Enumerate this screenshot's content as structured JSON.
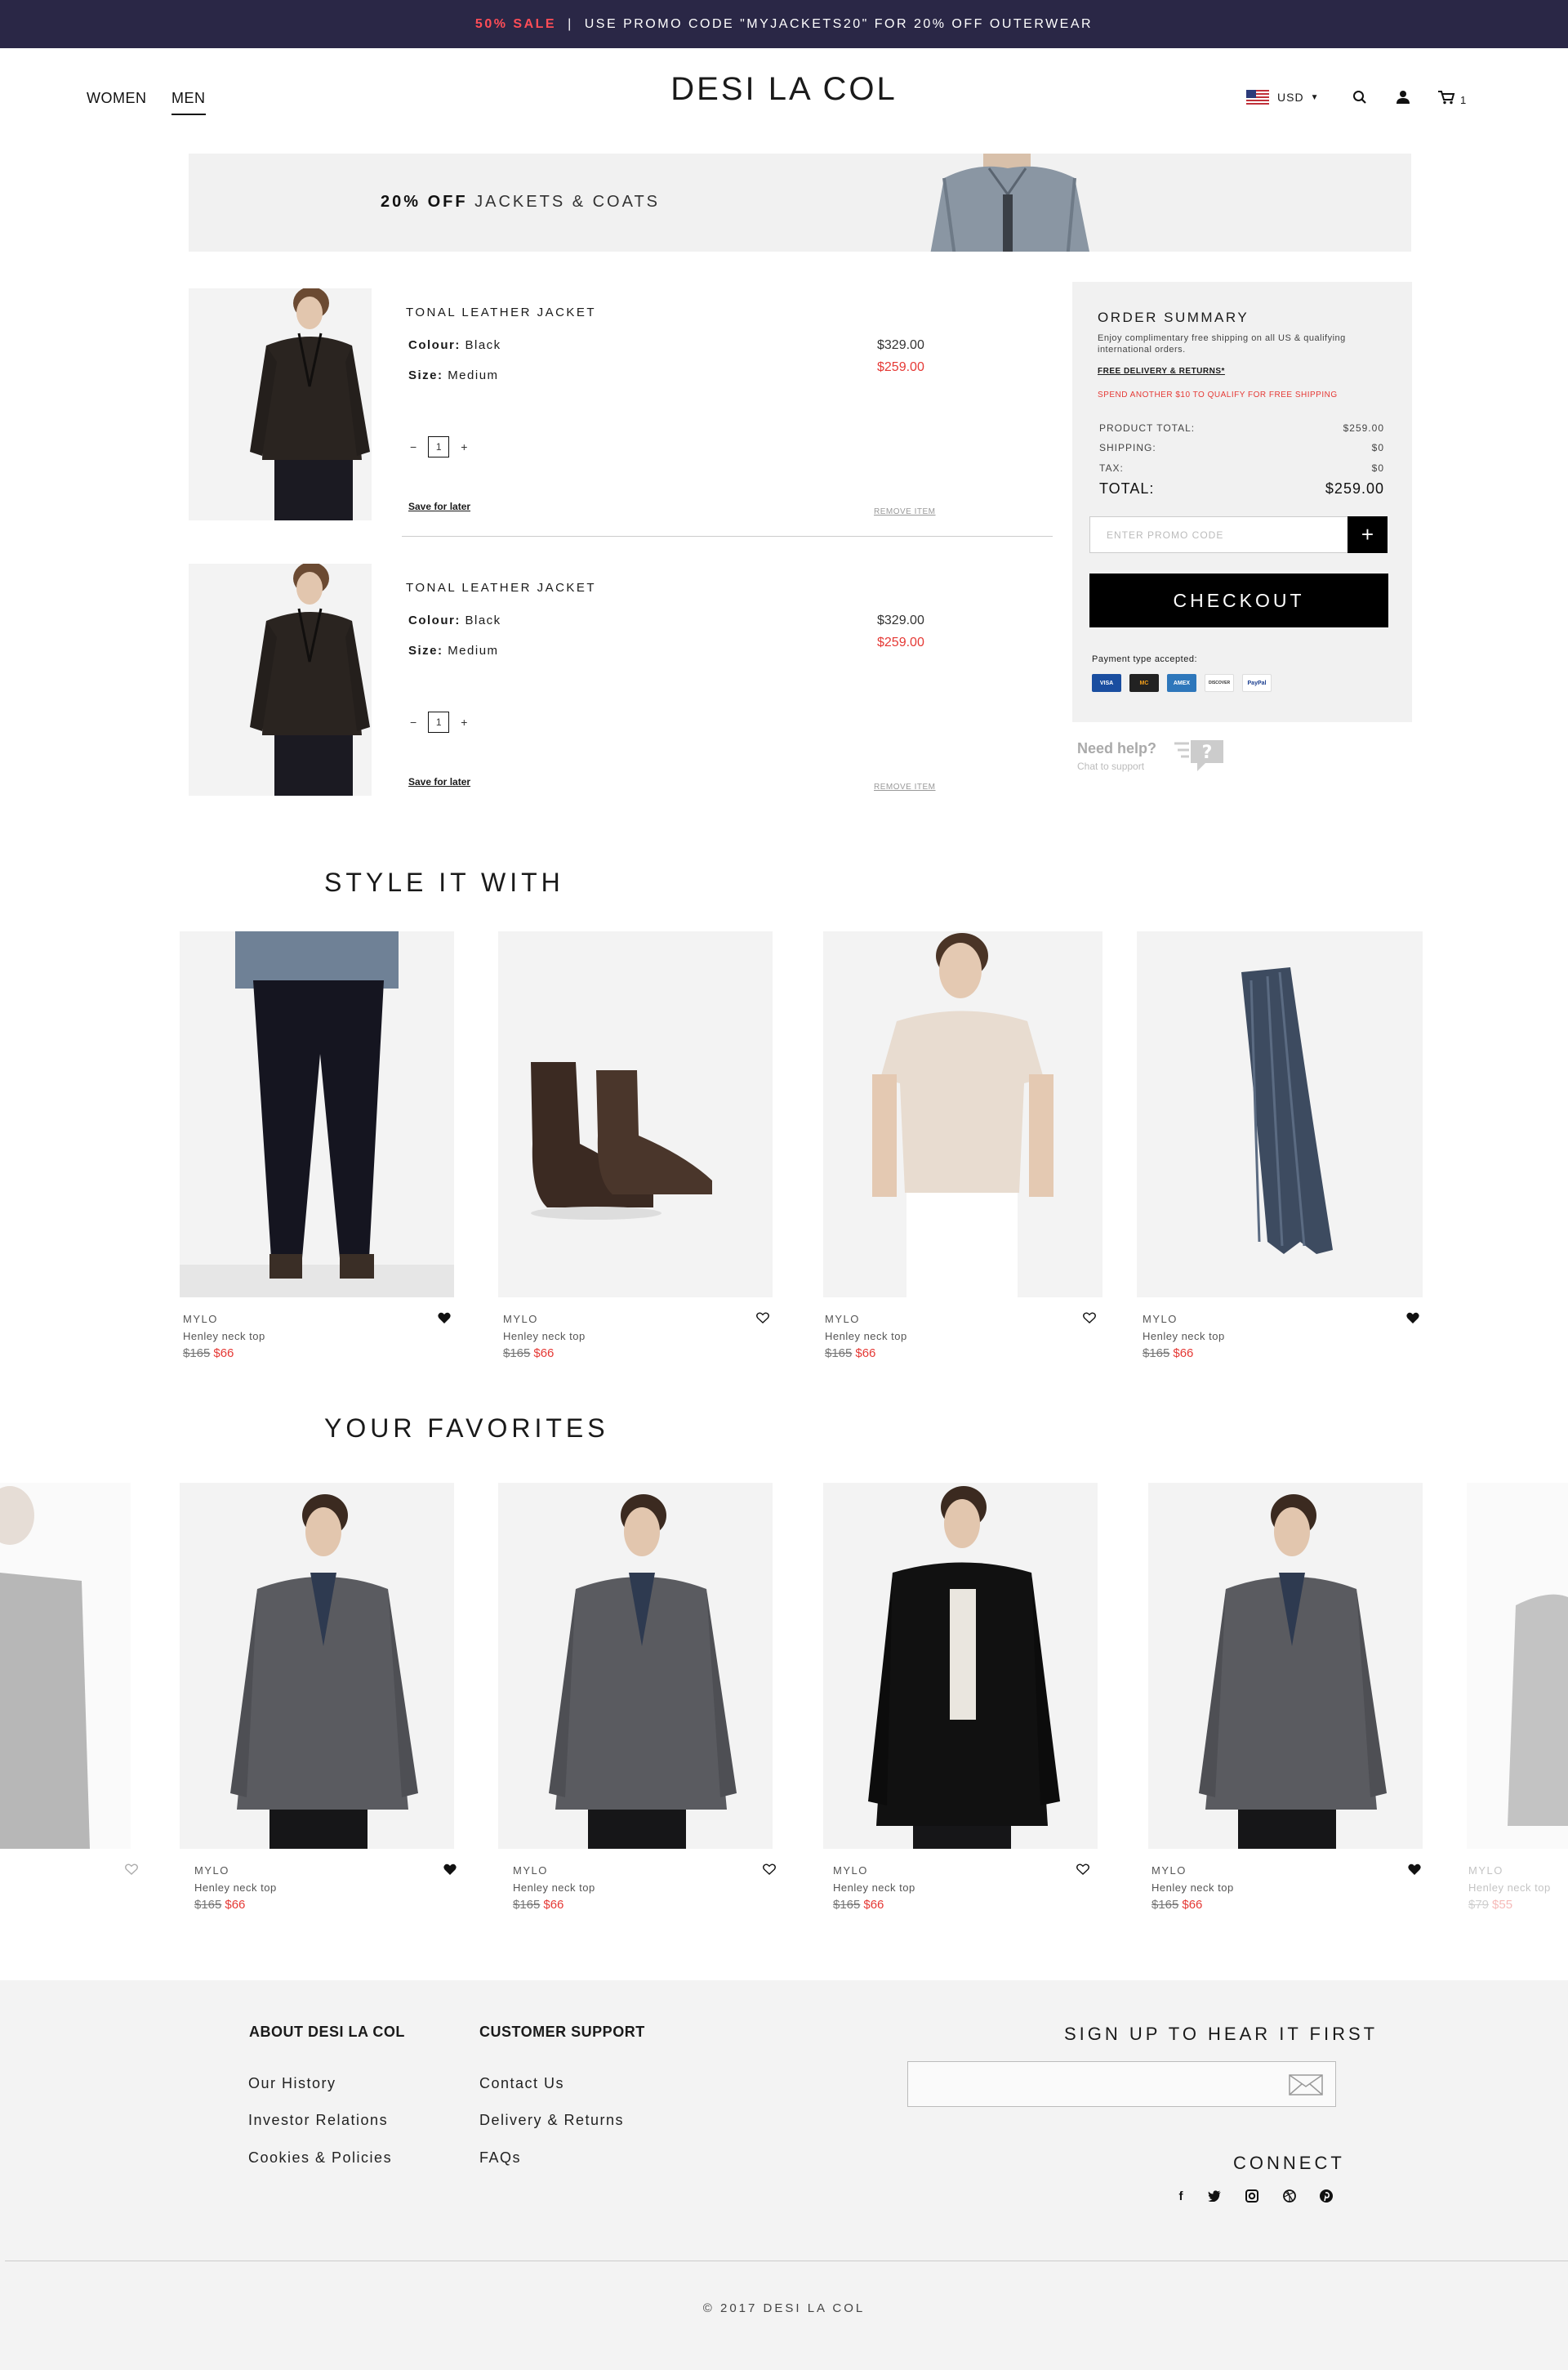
{
  "promo": {
    "sale": "50% SALE",
    "separator": "|",
    "message": "USE PROMO CODE \"MYJACKETS20\" FOR 20% OFF OUTERWEAR"
  },
  "header": {
    "nav_women": "WOMEN",
    "nav_men": "MEN",
    "logo": "DESI LA COL",
    "currency": "USD",
    "cart_count": "1"
  },
  "banner": {
    "highlight": "20% OFF",
    "text": "JACKETS & COATS"
  },
  "cart": {
    "items": [
      {
        "name": "TONAL LEATHER JACKET",
        "colour_label": "Colour:",
        "colour": "Black",
        "size_label": "Size:",
        "size": "Medium",
        "price_old": "$329.00",
        "price_new": "$259.00",
        "minus": "−",
        "qty": "1",
        "plus": "+",
        "save_later": "Save for later",
        "remove": "REMOVE ITEM"
      },
      {
        "name": "TONAL LEATHER JACKET",
        "colour_label": "Colour:",
        "colour": "Black",
        "size_label": "Size:",
        "size": "Medium",
        "price_old": "$329.00",
        "price_new": "$259.00",
        "minus": "−",
        "qty": "1",
        "plus": "+",
        "save_later": "Save for later",
        "remove": "REMOVE ITEM"
      }
    ]
  },
  "summary": {
    "title": "ORDER SUMMARY",
    "note": "Enjoy complimentary free shipping on all US & qualifying international orders.",
    "free_delivery": "FREE DELIVERY & RETURNS*",
    "spend_more": "SPEND ANOTHER $10 TO QUALIFY FOR FREE SHIPPING",
    "product_total_label": "PRODUCT TOTAL:",
    "product_total": "$259.00",
    "shipping_label": "SHIPPING:",
    "shipping": "$0",
    "tax_label": "TAX:",
    "tax": "$0",
    "total_label": "TOTAL:",
    "total": "$259.00",
    "promo_placeholder": "ENTER PROMO CODE",
    "promo_add": "+",
    "checkout": "CHECKOUT",
    "payment_label": "Payment type accepted:",
    "cards": [
      "VISA",
      "MC",
      "AMEX",
      "DISCOVER",
      "PayPal"
    ]
  },
  "help": {
    "title": "Need help?",
    "subtitle": "Chat to support"
  },
  "style_it_with": {
    "title": "STYLE IT WITH",
    "products": [
      {
        "brand": "MYLO",
        "name": "Henley neck top",
        "old": "$165",
        "new": "$66",
        "icon": "heart-filled-icon"
      },
      {
        "brand": "MYLO",
        "name": "Henley neck top",
        "old": "$165",
        "new": "$66",
        "icon": "heart-outline-icon"
      },
      {
        "brand": "MYLO",
        "name": "Henley neck top",
        "old": "$165",
        "new": "$66",
        "icon": "heart-outline-icon"
      },
      {
        "brand": "MYLO",
        "name": "Henley neck top",
        "old": "$165",
        "new": "$66",
        "icon": "heart-filled-icon"
      }
    ]
  },
  "favorites": {
    "title": "YOUR FAVORITES",
    "products": [
      {
        "brand": "MYLO",
        "name": "Henley neck top",
        "old": "$165",
        "new": "$66",
        "icon": "heart-filled-icon"
      },
      {
        "brand": "MYLO",
        "name": "Henley neck top",
        "old": "$165",
        "new": "$66",
        "icon": "heart-outline-icon"
      },
      {
        "brand": "MYLO",
        "name": "Henley neck top",
        "old": "$165",
        "new": "$66",
        "icon": "heart-outline-icon"
      },
      {
        "brand": "MYLO",
        "name": "Henley neck top",
        "old": "$165",
        "new": "$66",
        "icon": "heart-filled-icon"
      },
      {
        "brand": "MYLO",
        "name": "Henley neck top",
        "old": "$79",
        "new": "$55",
        "icon": "heart-outline-icon"
      }
    ]
  },
  "footer": {
    "about_title": "ABOUT DESI LA COL",
    "about_links": [
      "Our History",
      "Investor Relations",
      "Cookies & Policies"
    ],
    "support_title": "CUSTOMER SUPPORT",
    "support_links": [
      "Contact Us",
      "Delivery & Returns",
      "FAQs"
    ],
    "signup_title": "SIGN UP TO HEAR IT FIRST",
    "connect_title": "CONNECT",
    "social": [
      "facebook-icon",
      "twitter-icon",
      "instagram-icon",
      "dribbble-icon",
      "pinterest-icon"
    ],
    "copyright": "© 2017 DESI LA COL"
  },
  "colors": {
    "promo_bg": "#2a2746",
    "sale_red": "#e53935",
    "summary_bg": "#f1f1f1"
  }
}
